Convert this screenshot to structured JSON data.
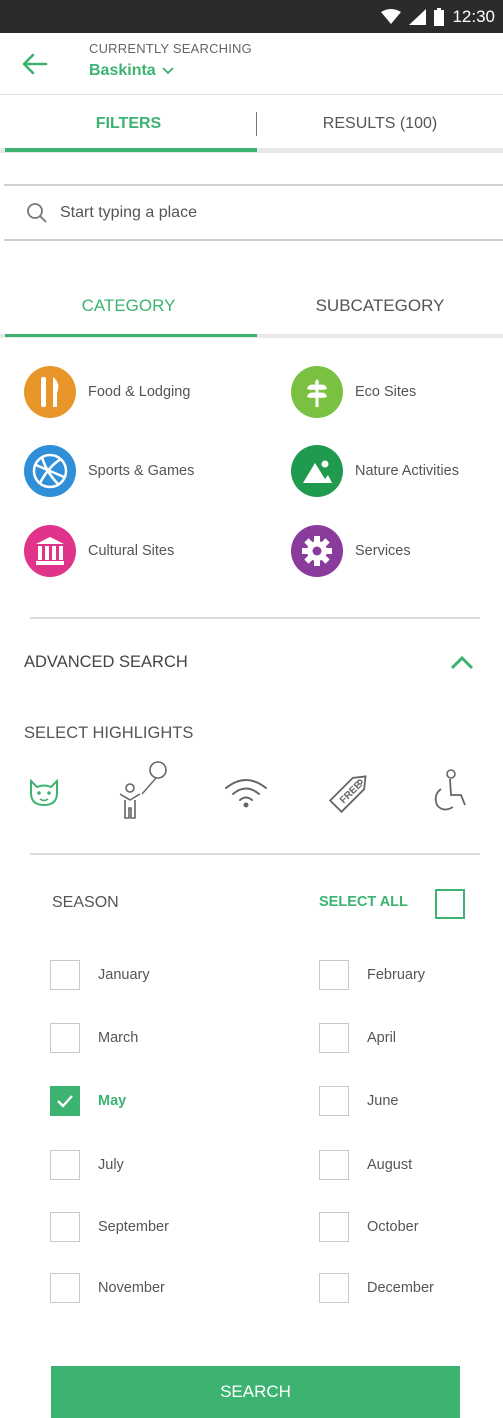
{
  "status_bar": {
    "time": "12:30",
    "icons": [
      "wifi-icon",
      "cell-signal-icon",
      "battery-icon"
    ]
  },
  "header": {
    "label": "CURRENTLY SEARCHING",
    "place": "Baskinta"
  },
  "tabs": {
    "filters": "FILTERS",
    "results": "RESULTS (100)"
  },
  "search": {
    "placeholder": "Start typing a place"
  },
  "category_tabs": {
    "category": "CATEGORY",
    "subcategory": "SUBCATEGORY"
  },
  "categories": [
    {
      "label": "Food & Lodging",
      "color": "#e8962a",
      "icon": "utensils-icon"
    },
    {
      "label": "Eco Sites",
      "color": "#7ac142",
      "icon": "leaf-icon"
    },
    {
      "label": "Sports & Games",
      "color": "#2f8fd8",
      "icon": "ball-icon"
    },
    {
      "label": "Nature Activities",
      "color": "#1f9a4e",
      "icon": "mountain-icon"
    },
    {
      "label": "Cultural Sites",
      "color": "#e0338a",
      "icon": "museum-icon"
    },
    {
      "label": "Services",
      "color": "#8a3c9c",
      "icon": "gear-icon"
    }
  ],
  "advanced": {
    "title": "ADVANCED SEARCH",
    "highlights_title": "SELECT HIGHLIGHTS"
  },
  "highlights": [
    {
      "icon": "pet-friendly-icon",
      "active": true
    },
    {
      "icon": "kids-friendly-icon",
      "active": false
    },
    {
      "icon": "wifi-icon",
      "active": false
    },
    {
      "icon": "free-tag-icon",
      "active": false
    },
    {
      "icon": "wheelchair-icon",
      "active": false
    }
  ],
  "highlight_free_text": "FREE",
  "season": {
    "title": "SEASON",
    "select_all": "SELECT ALL",
    "months": [
      {
        "label": "January",
        "checked": false
      },
      {
        "label": "February",
        "checked": false
      },
      {
        "label": "March",
        "checked": false
      },
      {
        "label": "April",
        "checked": false
      },
      {
        "label": "May",
        "checked": true
      },
      {
        "label": "June",
        "checked": false
      },
      {
        "label": "July",
        "checked": false
      },
      {
        "label": "August",
        "checked": false
      },
      {
        "label": "September",
        "checked": false
      },
      {
        "label": "October",
        "checked": false
      },
      {
        "label": "November",
        "checked": false
      },
      {
        "label": "December",
        "checked": false
      }
    ]
  },
  "search_button": "SEARCH",
  "colors": {
    "accent": "#3cb371",
    "status_bar": "#2b2b2b"
  }
}
